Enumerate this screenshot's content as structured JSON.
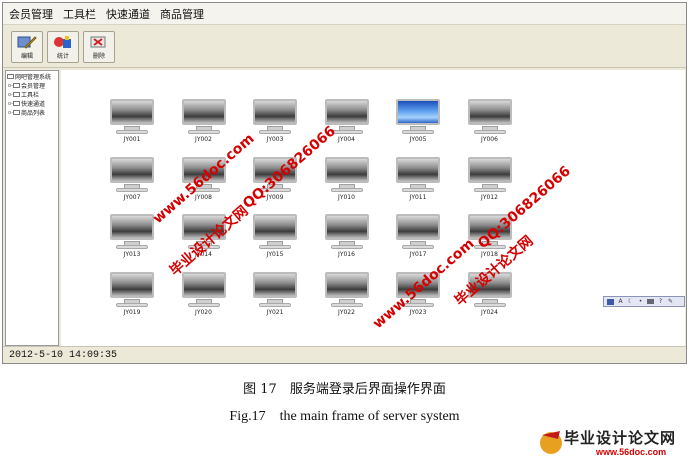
{
  "menubar": {
    "items": [
      "会员管理",
      "工具栏",
      "快速通道",
      "商品管理"
    ]
  },
  "toolbar": {
    "buttons": [
      {
        "label": "编辑",
        "icon": "edit-icon"
      },
      {
        "label": "统计",
        "icon": "stats-icon"
      },
      {
        "label": "删除",
        "icon": "delete-icon"
      }
    ]
  },
  "tree": {
    "root": "网吧管理系统",
    "items": [
      "会员管理",
      "工具栏",
      "快速通道",
      "商品列表"
    ]
  },
  "terminals": [
    "JY001",
    "JY002",
    "JY003",
    "JY004",
    "JY005",
    "JY006",
    "JY007",
    "JY008",
    "JY009",
    "JY010",
    "JY011",
    "JY012",
    "JY013",
    "JY014",
    "JY015",
    "JY016",
    "JY017",
    "JY018",
    "JY019",
    "JY020",
    "JY021",
    "JY022",
    "JY023",
    "JY024"
  ],
  "active_terminal": "JY005",
  "status": {
    "datetime": "2012-5-10 14:09:35"
  },
  "caption": {
    "cn": "图 17　服务端登录后界面操作界面",
    "en": "Fig.17　the main frame of server system"
  },
  "watermark": {
    "url": "www.56doc.com",
    "title": "毕业设计论文网",
    "qq": "QQ:306826066"
  },
  "logo": {
    "text": "毕业设计论文网",
    "url": "www.56doc.com"
  },
  "colors": {
    "watermark": "#d60000",
    "active_screen": "#3a7fe0",
    "window_bg": "#ece9d8"
  }
}
